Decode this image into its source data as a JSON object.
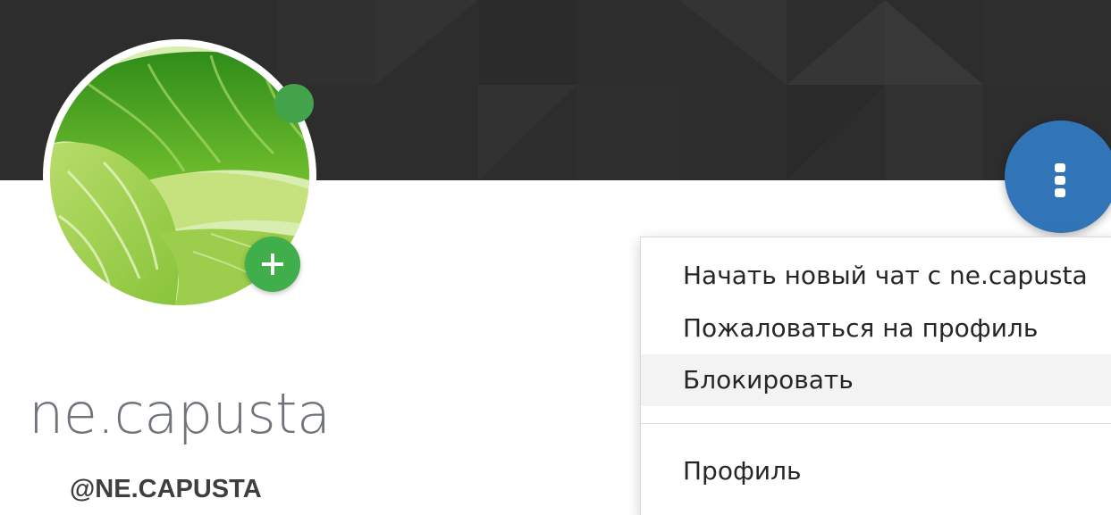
{
  "profile": {
    "display_name": "ne.capusta",
    "username": "@NE.CAPUSTA",
    "avatar_icon": "cabbage-photo",
    "status_color": "#43a34a",
    "add_icon": "plus-icon"
  },
  "actions": {
    "more_icon": "more-vertical-icon",
    "fab_color": "#3274b8"
  },
  "menu": {
    "items": [
      {
        "label": "Начать новый чат с ne.capusta"
      },
      {
        "label": "Пожаловаться на профиль"
      },
      {
        "label": "Блокировать",
        "highlighted": true
      },
      {
        "label": "Профиль"
      }
    ]
  },
  "colors": {
    "banner": "#2d2d2d",
    "accent_green": "#3fae4b",
    "accent_blue": "#3274b8"
  }
}
